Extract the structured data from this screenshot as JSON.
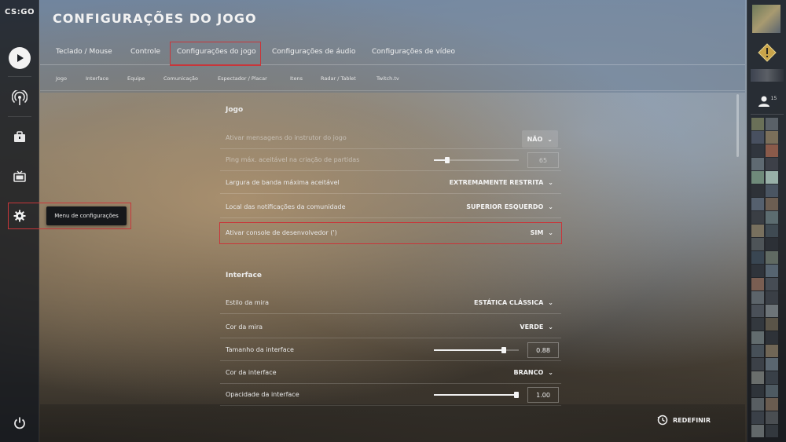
{
  "app": {
    "logo": "CS:GO",
    "title": "CONFIGURAÇÕES DO JOGO"
  },
  "tooltip": "Menu de configurações",
  "tabs": [
    {
      "label": "Teclado / Mouse"
    },
    {
      "label": "Controle"
    },
    {
      "label": "Configurações do jogo",
      "active": true
    },
    {
      "label": "Configurações de áudio"
    },
    {
      "label": "Configurações de vídeo"
    }
  ],
  "subtabs": [
    {
      "label": "Jogo"
    },
    {
      "label": "Interface"
    },
    {
      "label": "Equipe"
    },
    {
      "label": "Comunicação"
    },
    {
      "label": "Espectador / Placar"
    },
    {
      "label": "Itens"
    },
    {
      "label": "Radar / Tablet"
    },
    {
      "label": "Twitch.tv"
    }
  ],
  "sections": {
    "game": {
      "title": "Jogo",
      "rows": [
        {
          "label": "Ativar mensagens do instrutor do jogo",
          "value": "NÃO"
        },
        {
          "label": "Ping máx. aceitável na criação de partidas",
          "value": "65",
          "slider": 0.15
        },
        {
          "label": "Largura de banda máxima aceitável",
          "value": "EXTREMAMENTE RESTRITA"
        },
        {
          "label": "Local das notificações da comunidade",
          "value": "SUPERIOR ESQUERDO"
        },
        {
          "label": "Ativar console de desenvolvedor (')",
          "value": "SIM"
        }
      ]
    },
    "interface": {
      "title": "Interface",
      "rows": [
        {
          "label": "Estilo da mira",
          "value": "ESTÁTICA CLÁSSICA"
        },
        {
          "label": "Cor da mira",
          "value": "VERDE"
        },
        {
          "label": "Tamanho da interface",
          "value": "0.88",
          "slider": 0.88
        },
        {
          "label": "Cor da interface",
          "value": "BRANCO"
        },
        {
          "label": "Opacidade da interface",
          "value": "1.00",
          "slider": 1.0
        }
      ]
    }
  },
  "reset_label": "REDEFINIR",
  "friends_count": "15",
  "colors": {
    "highlight": "#c8363a",
    "sidebar": "#161a20"
  }
}
